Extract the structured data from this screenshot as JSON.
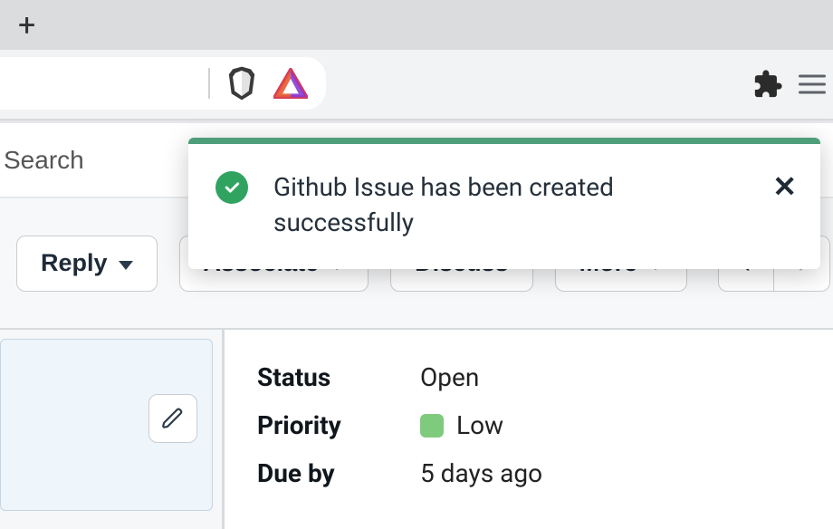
{
  "browser": {
    "new_tab_glyph": "+",
    "brave_lion_name": "brave-shield-icon",
    "brave_bat_name": "brave-bat-icon",
    "extensions_name": "extensions-icon",
    "menu_name": "hamburger-menu-icon"
  },
  "search": {
    "placeholder": "Search"
  },
  "actions": {
    "reply": "Reply",
    "associate": "Associate",
    "discuss": "Discuss",
    "more": "More"
  },
  "pager": {
    "prev_glyph": "‹",
    "next_glyph": "›"
  },
  "details": {
    "status_label": "Status",
    "status_value": "Open",
    "priority_label": "Priority",
    "priority_value": "Low",
    "priority_color": "#7ecb7e",
    "dueby_label": "Due by",
    "dueby_value": "5 days ago"
  },
  "toast": {
    "message": "Github Issue has been created successfully",
    "close_glyph": "✕",
    "accent_color": "#4f9e7a"
  }
}
